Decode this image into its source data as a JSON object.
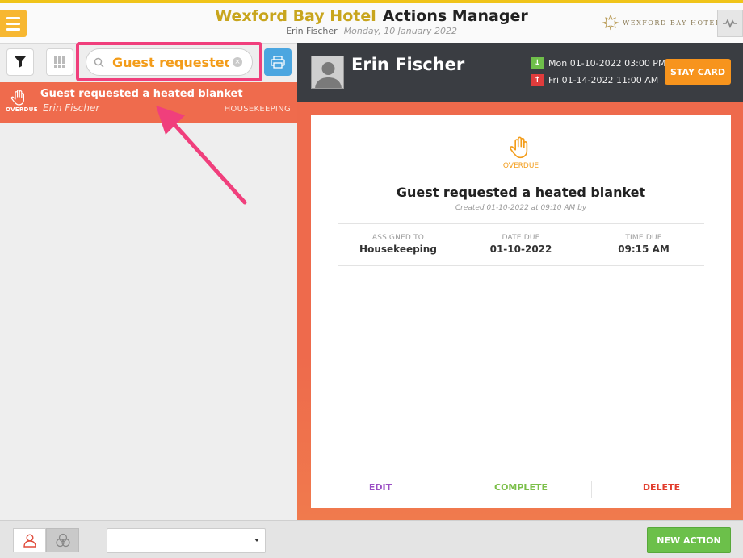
{
  "header": {
    "hotel_name": "Wexford Bay Hotel",
    "app_name": "Actions Manager",
    "user_name": "Erin Fischer",
    "date": "Monday, 10 January 2022",
    "brand_text": "WEXFORD BAY HOTEL"
  },
  "left_panel": {
    "search": {
      "value": "Guest requested"
    },
    "list": [
      {
        "title": "Guest requested a heated blanket",
        "name": "Erin Fischer",
        "department": "HOUSEKEEPING",
        "status": "OVERDUE"
      }
    ]
  },
  "guest": {
    "name": "Erin Fischer",
    "arrival": "Mon 01-10-2022  03:00 PM",
    "departure": "Fri 01-14-2022  11:00 AM",
    "stay_card_label": "STAY CARD"
  },
  "detail": {
    "status": "OVERDUE",
    "title": "Guest requested a heated blanket",
    "created": "Created 01-10-2022 at 09:10 AM by",
    "assigned_label": "ASSIGNED TO",
    "assigned_value": "Housekeeping",
    "date_due_label": "DATE DUE",
    "date_due_value": "01-10-2022",
    "time_due_label": "TIME DUE",
    "time_due_value": "09:15 AM",
    "edit_label": "EDIT",
    "complete_label": "COMPLETE",
    "delete_label": "DELETE"
  },
  "bottom": {
    "new_action_label": "NEW ACTION"
  },
  "colors": {
    "accent_orange": "#f39c19",
    "overdue_red": "#ef6b4d",
    "annotation_pink": "#f03f7c",
    "complete_green": "#6cc04a"
  }
}
